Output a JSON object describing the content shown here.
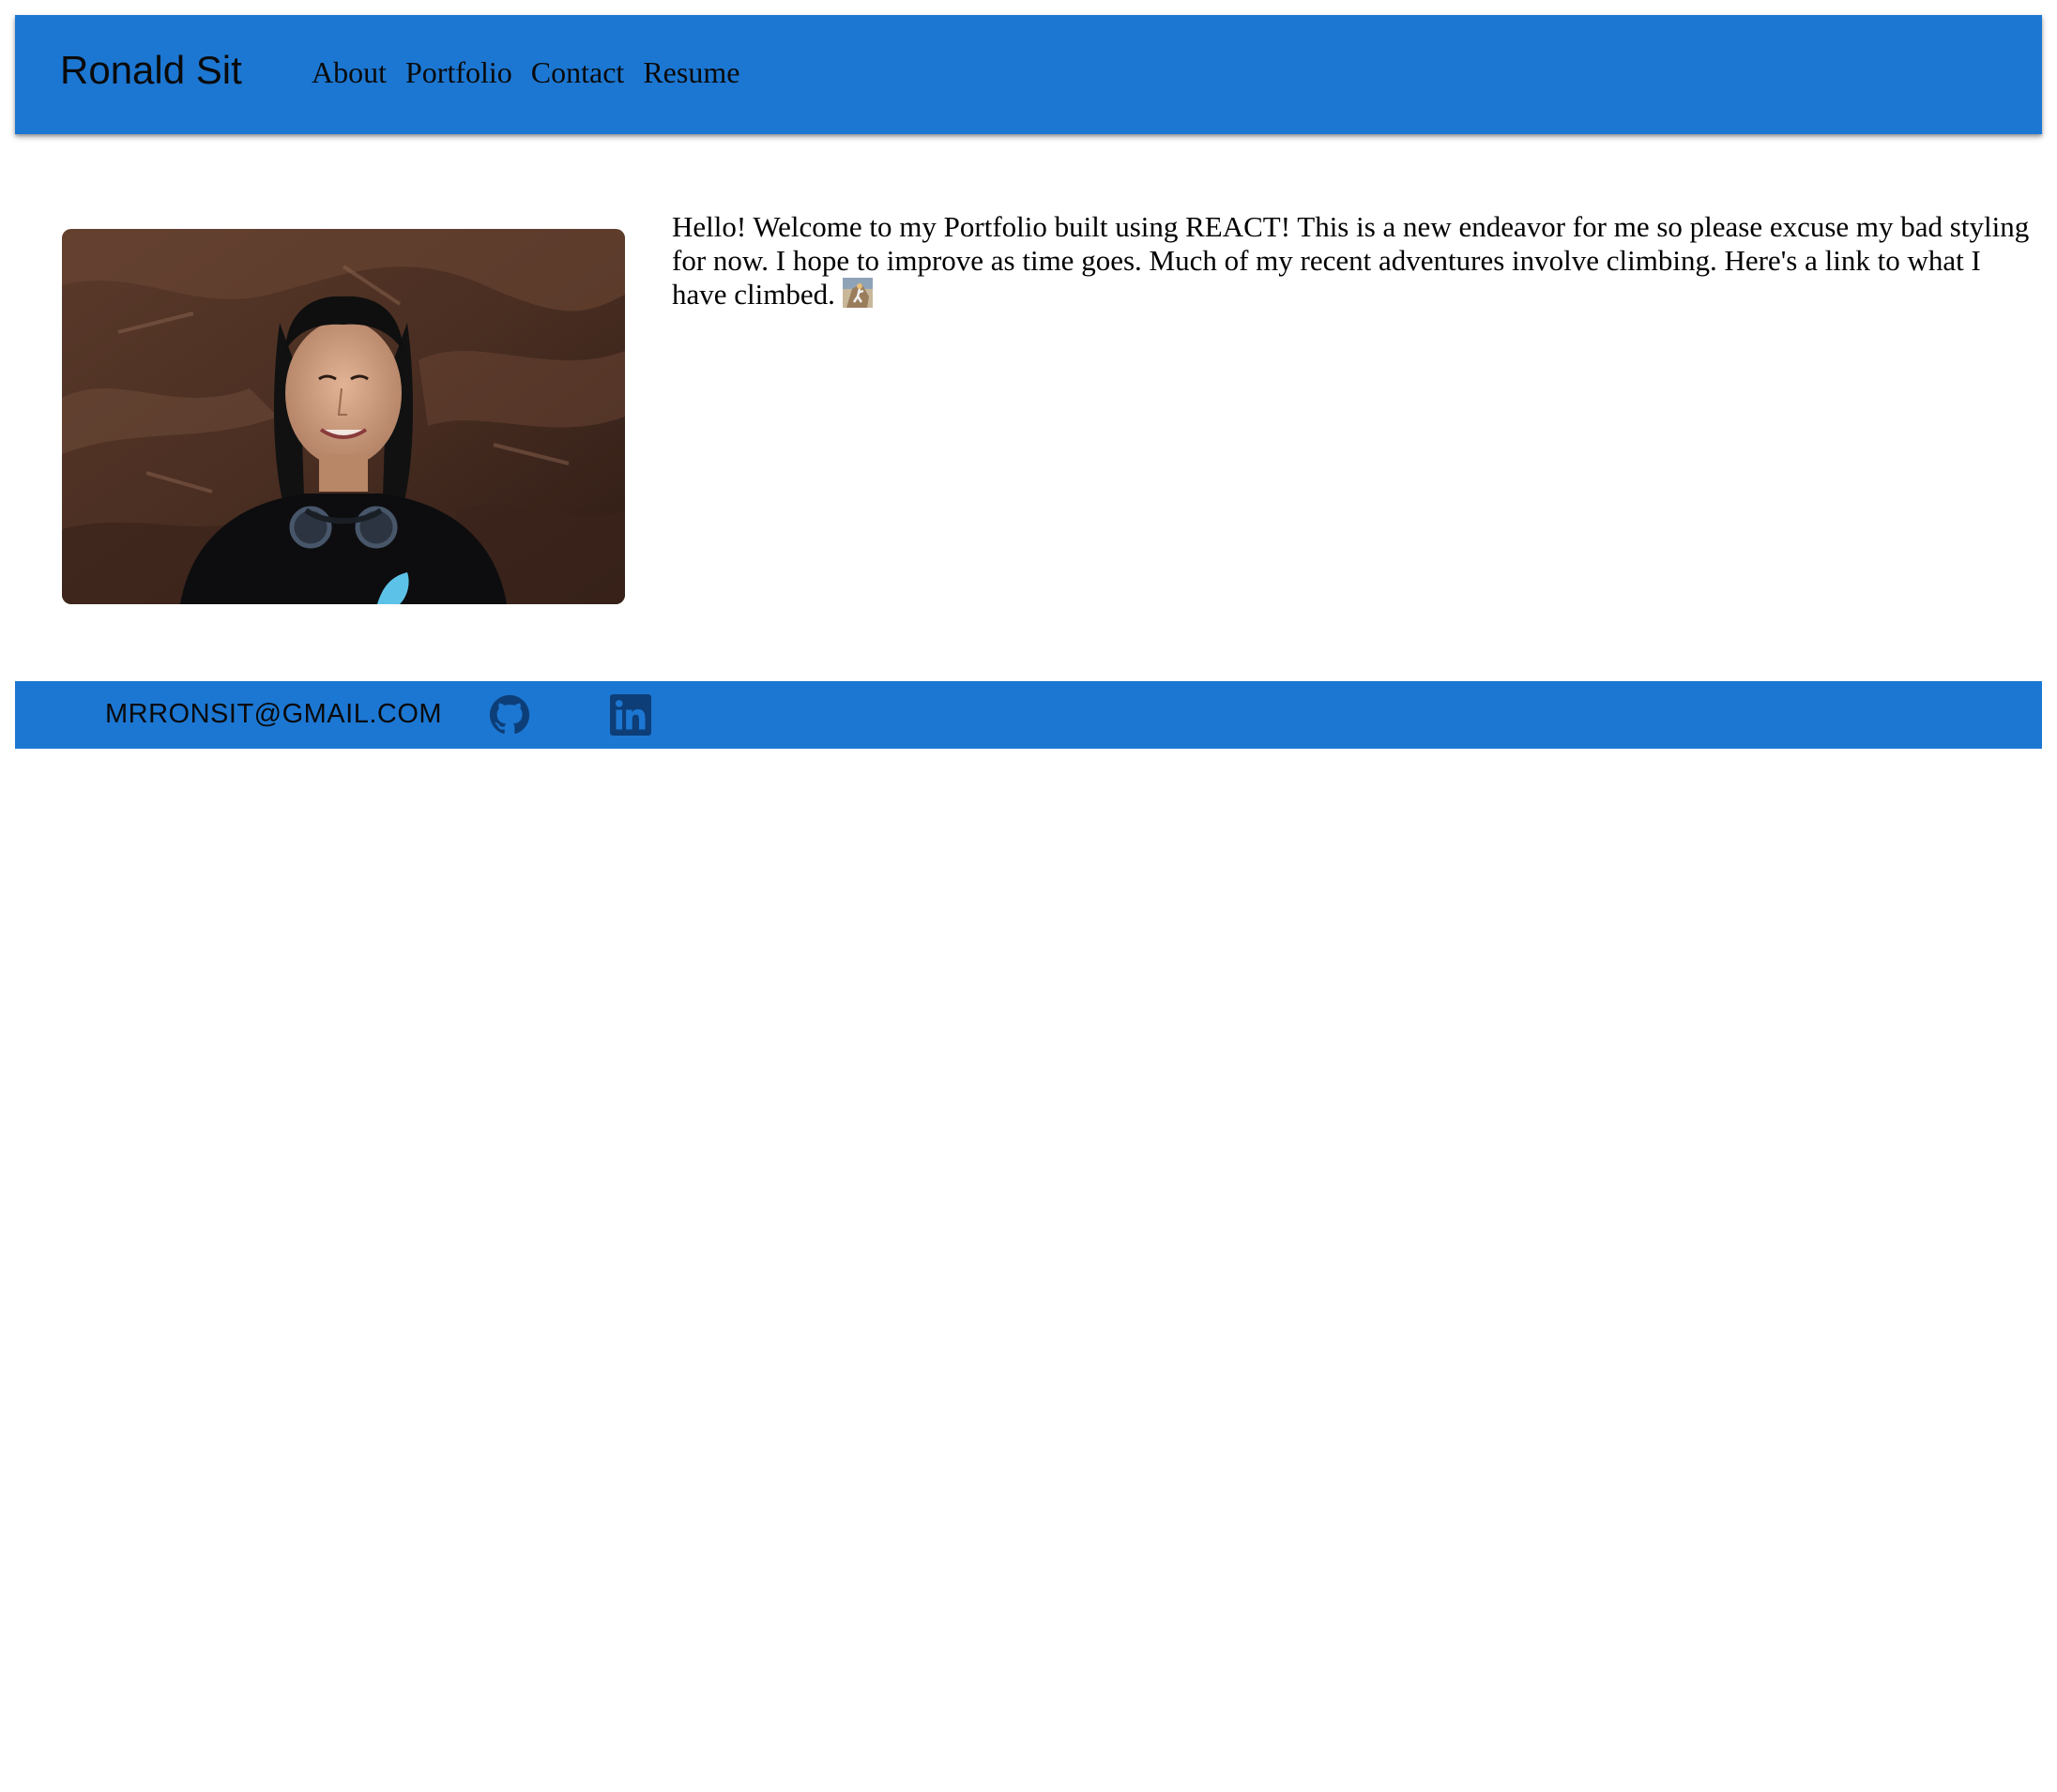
{
  "header": {
    "brand": "Ronald Sit",
    "nav": [
      {
        "label": "About"
      },
      {
        "label": "Portfolio"
      },
      {
        "label": "Contact"
      },
      {
        "label": "Resume"
      }
    ]
  },
  "main": {
    "intro_text": "Hello! Welcome to my Portfolio built using REACT! This is a new endeavor for me so please excuse my bad styling for now. I hope to improve as time goes. Much of my recent adventures involve climbing. Here's a link to what I have climbed. ",
    "climb_link_icon": "climber-image-icon"
  },
  "footer": {
    "email": "MRRONSIT@GMAIL.COM",
    "icons": [
      "github-icon",
      "linkedin-icon"
    ]
  },
  "colors": {
    "brand_blue": "#1c77d2",
    "footer_icon": "#0d3e78"
  }
}
